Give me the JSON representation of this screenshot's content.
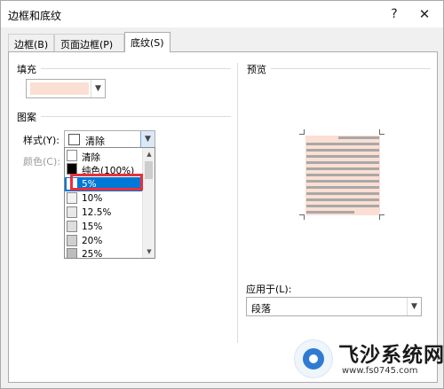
{
  "window": {
    "title": "边框和底纹",
    "help_label": "?",
    "close_label": "✕"
  },
  "tabs": [
    {
      "label": "边框(B)"
    },
    {
      "label": "页面边框(P)"
    },
    {
      "label": "底纹(S)",
      "active": true
    }
  ],
  "fill": {
    "section_label": "填充",
    "color": "#fbdfd3"
  },
  "pattern": {
    "section_label": "图案",
    "style_label": "样式(Y):",
    "style_value": "清除",
    "color_label": "颜色(C):",
    "options": [
      {
        "label": "清除",
        "swatch": "#ffffff"
      },
      {
        "label": "纯色(100%)",
        "swatch": "#000000"
      },
      {
        "label": "5%",
        "swatch": "#ffffff",
        "selected": true
      },
      {
        "label": "10%",
        "swatch": "#f2f2f2"
      },
      {
        "label": "12.5%",
        "swatch": "#e8e8e8"
      },
      {
        "label": "15%",
        "swatch": "#dedede"
      },
      {
        "label": "20%",
        "swatch": "#cfcfcf"
      },
      {
        "label": "25%",
        "swatch": "#bdbdbd"
      }
    ]
  },
  "preview": {
    "section_label": "预览"
  },
  "apply_to": {
    "label": "应用于(L):",
    "value": "段落"
  },
  "watermark": {
    "title": "飞沙系统网",
    "url": "www.fs0745.com"
  },
  "colors": {
    "selection": "#0078d7",
    "highlight_box": "#e8303a",
    "shading": "#fbdfd3"
  }
}
